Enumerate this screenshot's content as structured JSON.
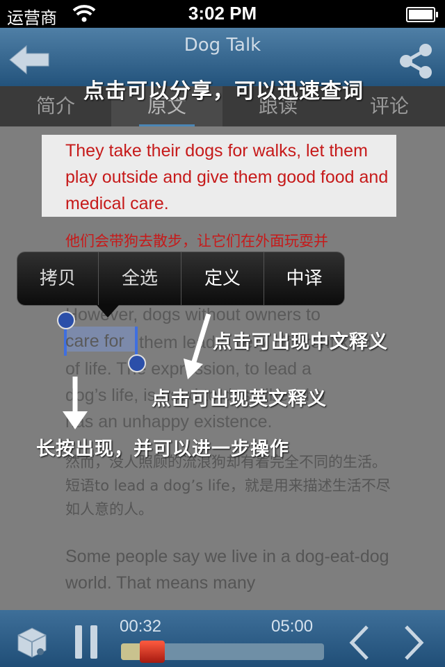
{
  "status_bar": {
    "carrier": "运营商",
    "time": "3:02 PM"
  },
  "nav": {
    "title": "Dog Talk"
  },
  "tabs": [
    {
      "label": "简介"
    },
    {
      "label": "原文"
    },
    {
      "label": "跟读"
    },
    {
      "label": "评论"
    }
  ],
  "article": {
    "highlighted_en": "They take their dogs for walks, let them play outside and give them good food and medical care.",
    "highlighted_cn": "他们会带狗去散步，让它们在外面玩耍并",
    "para2_line1": "However, dogs without owners to",
    "para2_line2_rest": " them lead a very different kind",
    "para2_line3": "of life. The expression, to lead a",
    "para2_line4": "dog’s life, is used to describe who",
    "para2_line5": "has an unhappy existence.",
    "para2_cn": "然而，没人照顾的流浪狗却有着完全不同的生活。短语to lead a dog’s life，就是用来描述生活不尽如人意的人。",
    "para3": "Some people say we live in a dog-eat-dog world. That means many"
  },
  "selection": {
    "text": "care for"
  },
  "context_menu": {
    "copy": "拷贝",
    "select_all": "全选",
    "define": "定义",
    "translate": "中译"
  },
  "annotations": {
    "share": "点击可以分享，可以迅速查词",
    "chinese": "点击可出现中文释义",
    "english": "点击可出现英文释义",
    "longpress": "长按出现，并可以进一步操作"
  },
  "player": {
    "current": "00:32",
    "total": "05:00",
    "progress": 0.107
  }
}
